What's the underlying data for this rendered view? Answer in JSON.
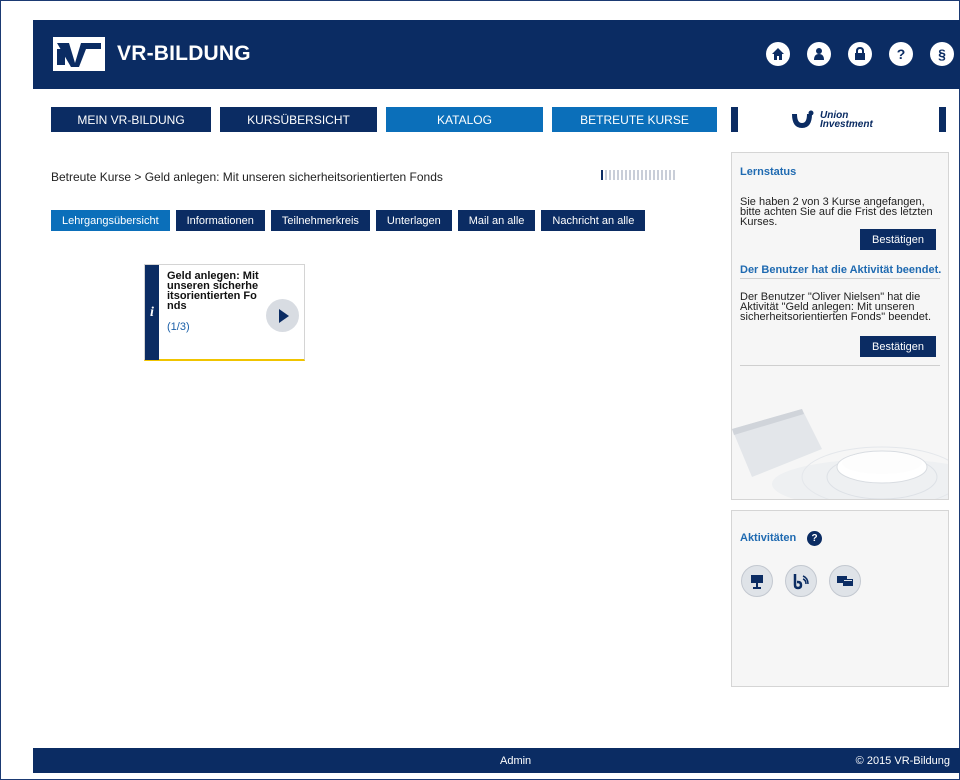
{
  "header": {
    "brand": "VR-BILDUNG",
    "icons": [
      "home-icon",
      "user-icon",
      "lock-icon",
      "help-icon",
      "paragraph-icon"
    ],
    "icon_glyphs": [
      "⌂",
      "●",
      "🔒",
      "?",
      "§"
    ]
  },
  "mainnav": {
    "items": [
      {
        "label": "MEIN VR-BILDUNG",
        "active": false
      },
      {
        "label": "KURSÜBERSICHT",
        "active": false
      },
      {
        "label": "KATALOG",
        "active": false
      },
      {
        "label": "BETREUTE KURSE",
        "active": true
      }
    ],
    "partner": {
      "line1": "Union",
      "line2": "Investment"
    }
  },
  "breadcrumb": "Betreute Kurse > Geld anlegen: Mit unseren sicherheitsorientierten Fonds",
  "progress": {
    "segments": 19,
    "filled": 1
  },
  "subnav": {
    "items": [
      {
        "label": "Lehrgangsübersicht",
        "active": true
      },
      {
        "label": "Informationen",
        "active": false
      },
      {
        "label": "Teilnehmerkreis",
        "active": false
      },
      {
        "label": "Unterlagen",
        "active": false
      },
      {
        "label": "Mail an alle",
        "active": false
      },
      {
        "label": "Nachricht an alle",
        "active": false
      }
    ]
  },
  "course_tile": {
    "info_glyph": "i",
    "title": "Geld anlegen: Mit unseren sicherheitsorientierten Fonds",
    "count": "(1/3)"
  },
  "lernstatus": {
    "title": "Lernstatus",
    "text": "Sie haben 2 von 3 Kurse angefangen, bitte achten Sie auf die Frist des letzten Kurses.",
    "confirm_label": "Bestätigen",
    "notice_title": "Der Benutzer hat die Aktivität beendet.",
    "notice_text": "Der Benutzer \"Oliver Nielsen\" hat die Aktivität \"Geld anlegen: Mit unseren sicherheitsorientierten Fonds\" beendet.",
    "notice_confirm_label": "Bestätigen"
  },
  "aktivitaeten": {
    "title": "Aktivitäten",
    "help_glyph": "?",
    "icons": [
      "webinar-icon",
      "feed-icon",
      "chat-icon"
    ]
  },
  "footer": {
    "user": "Admin",
    "copyright": "© 2015 VR-Bildung"
  }
}
